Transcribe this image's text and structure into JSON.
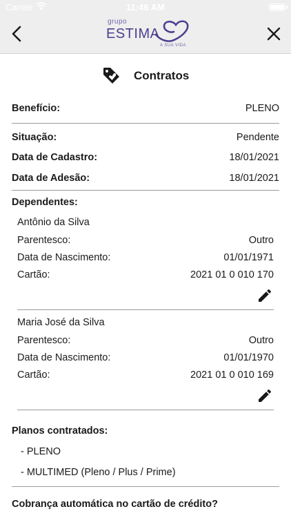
{
  "statusbar": {
    "carrier": "Carrier",
    "time": "11:46 AM"
  },
  "navbar": {
    "logo": {
      "grupo": "grupo",
      "brand": "ESTIMA",
      "tagline": "A SUA VIDA"
    },
    "back_icon": "chevron-left-icon",
    "close_icon": "close-icon",
    "colors": {
      "background": "#eeeeee",
      "brand": "#4a3f8f"
    }
  },
  "page": {
    "title": "Contratos",
    "icon": "tag-heart-icon"
  },
  "beneficio": {
    "label": "Benefício:",
    "value": "PLENO"
  },
  "situacao": {
    "label": "Situação:",
    "value": "Pendente"
  },
  "cadastro": {
    "label": "Data de Cadastro:",
    "value": "18/01/2021"
  },
  "adesao": {
    "label": "Data de Adesão:",
    "value": "18/01/2021"
  },
  "dependentes": {
    "label": "Dependentes:",
    "items": [
      {
        "name": "Antônio da Silva",
        "parentesco_label": "Parentesco:",
        "parentesco": "Outro",
        "nascimento_label": "Data de Nascimento:",
        "nascimento": "01/01/1971",
        "cartao_label": "Cartão:",
        "cartao": "2021 01 0 010 170"
      },
      {
        "name": "Maria José da Silva",
        "parentesco_label": "Parentesco:",
        "parentesco": "Outro",
        "nascimento_label": "Data de Nascimento:",
        "nascimento": "01/01/1970",
        "cartao_label": "Cartão:",
        "cartao": "2021 01 0 010 169"
      }
    ]
  },
  "planos": {
    "label": "Planos contratados:",
    "items": [
      "- PLENO",
      "- MULTIMED (Pleno / Plus / Prime)"
    ]
  },
  "cobranca": {
    "label": "Cobrança automática no cartão de crédito?"
  }
}
